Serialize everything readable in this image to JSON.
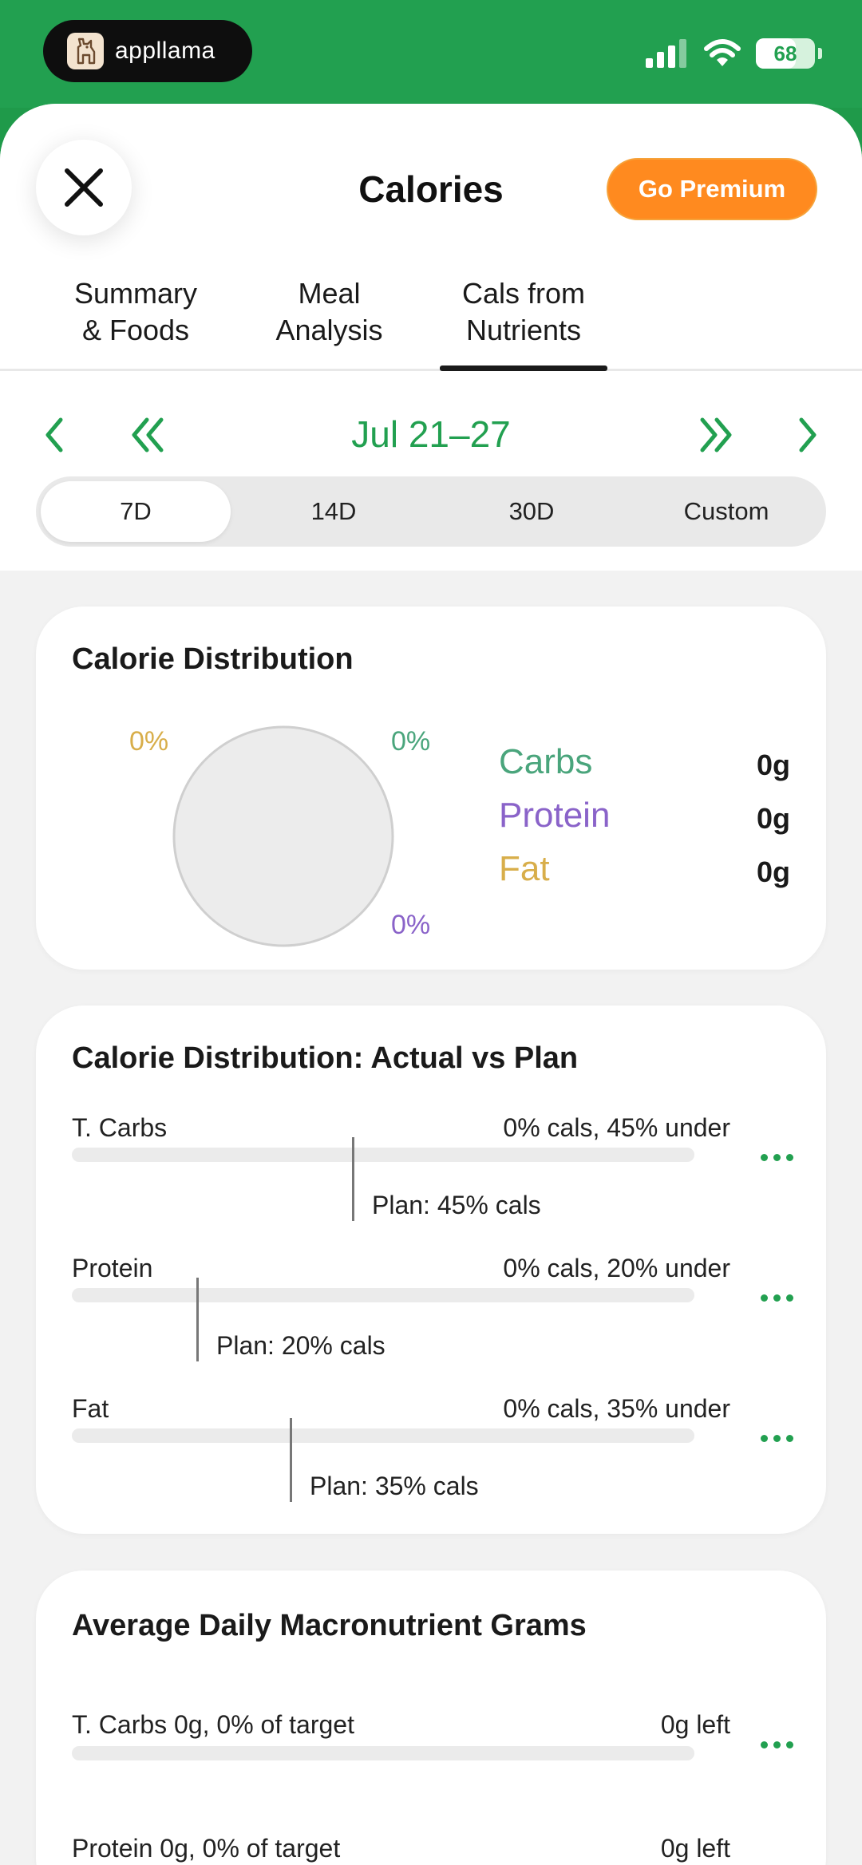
{
  "status_bar": {
    "app_name": "appllama",
    "battery": "68",
    "battery_level": 0.68,
    "icons": [
      "signal-icon",
      "wifi-icon",
      "battery-icon"
    ]
  },
  "header": {
    "title": "Calories",
    "premium_label": "Go Premium",
    "close_icon": "close-icon"
  },
  "tabs": [
    {
      "line1": "Summary",
      "line2": "& Foods"
    },
    {
      "line1": "Meal",
      "line2": "Analysis"
    },
    {
      "line1": "Cals from",
      "line2": "Nutrients"
    }
  ],
  "active_tab": 2,
  "date_nav": {
    "range": "Jul 21–27"
  },
  "periods": [
    "7D",
    "14D",
    "30D",
    "Custom"
  ],
  "active_period": 0,
  "distribution": {
    "title": "Calorie Distribution",
    "fat_pct": "0%",
    "carbs_pct": "0%",
    "protein_pct": "0%",
    "legend": [
      {
        "label": "Carbs",
        "value": "0g",
        "color": "#4aa57c"
      },
      {
        "label": "Protein",
        "value": "0g",
        "color": "#8a63c9"
      },
      {
        "label": "Fat",
        "value": "0g",
        "color": "#d8ae4a"
      }
    ]
  },
  "actual_vs_plan": {
    "title": "Calorie Distribution: Actual vs Plan",
    "rows": [
      {
        "label": "T. Carbs",
        "status": "0% cals, 45% under",
        "plan": "Plan: 45% cals",
        "plan_fraction": 0.45
      },
      {
        "label": "Protein",
        "status": "0% cals, 20% under",
        "plan": "Plan: 20% cals",
        "plan_fraction": 0.2
      },
      {
        "label": "Fat",
        "status": "0% cals, 35% under",
        "plan": "Plan: 35% cals",
        "plan_fraction": 0.35
      }
    ]
  },
  "macro_grams": {
    "title": "Average Daily Macronutrient Grams",
    "rows": [
      {
        "label": "T. Carbs 0g, 0% of target",
        "left": "0g left"
      },
      {
        "label": "Protein 0g, 0% of target",
        "left": "0g left"
      }
    ]
  }
}
